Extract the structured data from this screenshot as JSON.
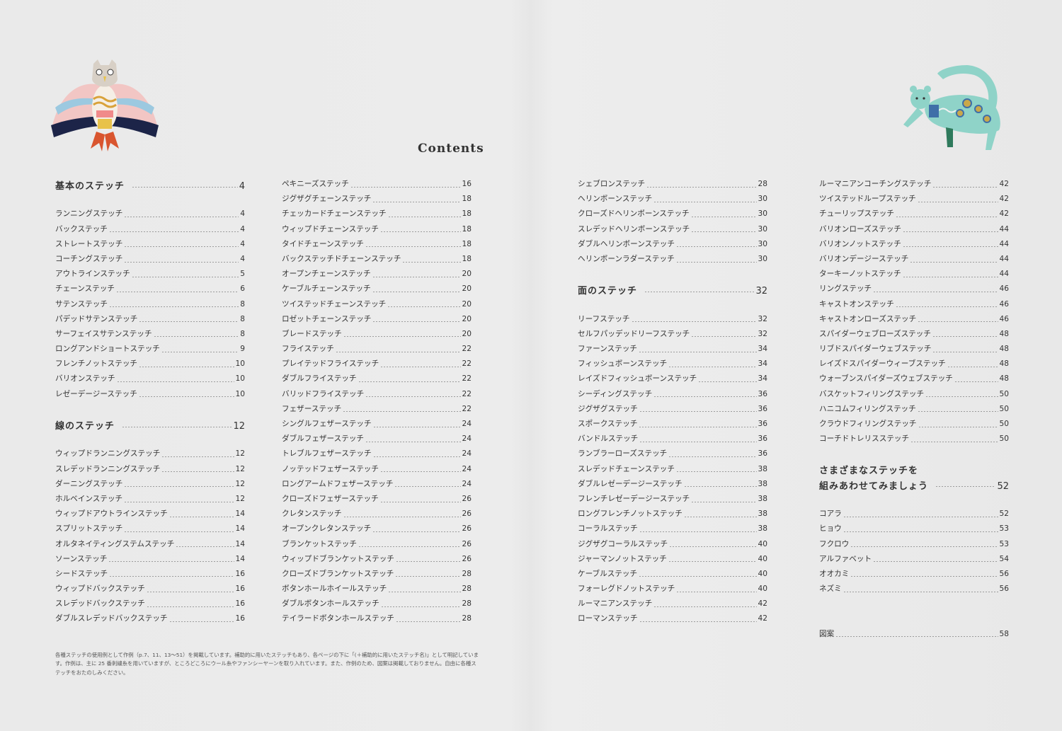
{
  "title": "Contents",
  "columns": [
    [
      {
        "type": "sec",
        "label": "基本のステッチ",
        "page": "4"
      },
      {
        "type": "gap"
      },
      {
        "label": "ランニングステッチ",
        "page": "4"
      },
      {
        "label": "バックステッチ",
        "page": "4"
      },
      {
        "label": "ストレートステッチ",
        "page": "4"
      },
      {
        "label": "コーチングステッチ",
        "page": "4"
      },
      {
        "label": "アウトラインステッチ",
        "page": "5"
      },
      {
        "label": "チェーンステッチ",
        "page": "6"
      },
      {
        "label": "サテンステッチ",
        "page": "8"
      },
      {
        "label": "パデッドサテンステッチ",
        "page": "8"
      },
      {
        "label": "サーフェイスサテンステッチ",
        "page": "8"
      },
      {
        "label": "ロングアンドショートステッチ",
        "page": "9"
      },
      {
        "label": "フレンチノットステッチ",
        "page": "10"
      },
      {
        "label": "バリオンステッチ",
        "page": "10"
      },
      {
        "label": "レゼーデージーステッチ",
        "page": "10"
      },
      {
        "type": "gap"
      },
      {
        "type": "sec",
        "label": "線のステッチ",
        "page": "12"
      },
      {
        "type": "gap"
      },
      {
        "label": "ウィップドランニングステッチ",
        "page": "12"
      },
      {
        "label": "スレデッドランニングステッチ",
        "page": "12"
      },
      {
        "label": "ダーニングステッチ",
        "page": "12"
      },
      {
        "label": "ホルベインステッチ",
        "page": "12"
      },
      {
        "label": "ウィップドアウトラインステッチ",
        "page": "14"
      },
      {
        "label": "スプリットステッチ",
        "page": "14"
      },
      {
        "label": "オルタネイティングステムステッチ",
        "page": "14"
      },
      {
        "label": "ソーンステッチ",
        "page": "14"
      },
      {
        "label": "シードステッチ",
        "page": "16"
      },
      {
        "label": "ウィップドバックステッチ",
        "page": "16"
      },
      {
        "label": "スレデッドバックステッチ",
        "page": "16"
      },
      {
        "label": "ダブルスレデッドバックステッチ",
        "page": "16"
      }
    ],
    [
      {
        "label": "ペキニーズステッチ",
        "page": "16"
      },
      {
        "label": "ジグザグチェーンステッチ",
        "page": "18"
      },
      {
        "label": "チェッカードチェーンステッチ",
        "page": "18"
      },
      {
        "label": "ウィップドチェーンステッチ",
        "page": "18"
      },
      {
        "label": "タイドチェーンステッチ",
        "page": "18"
      },
      {
        "label": "バックステッチドチェーンステッチ",
        "page": "18"
      },
      {
        "label": "オープンチェーンステッチ",
        "page": "20"
      },
      {
        "label": "ケーブルチェーンステッチ",
        "page": "20"
      },
      {
        "label": "ツイステッドチェーンステッチ",
        "page": "20"
      },
      {
        "label": "ロゼットチェーンステッチ",
        "page": "20"
      },
      {
        "label": "ブレードステッチ",
        "page": "20"
      },
      {
        "label": "フライステッチ",
        "page": "22"
      },
      {
        "label": "プレイテッドフライステッチ",
        "page": "22"
      },
      {
        "label": "ダブルフライステッチ",
        "page": "22"
      },
      {
        "label": "バリッドフライステッチ",
        "page": "22"
      },
      {
        "label": "フェザーステッチ",
        "page": "22"
      },
      {
        "label": "シングルフェザーステッチ",
        "page": "24"
      },
      {
        "label": "ダブルフェザーステッチ",
        "page": "24"
      },
      {
        "label": "トレブルフェザーステッチ",
        "page": "24"
      },
      {
        "label": "ノッテッドフェザーステッチ",
        "page": "24"
      },
      {
        "label": "ロングアームドフェザーステッチ",
        "page": "24"
      },
      {
        "label": "クローズドフェザーステッチ",
        "page": "26"
      },
      {
        "label": "クレタンステッチ",
        "page": "26"
      },
      {
        "label": "オープンクレタンステッチ",
        "page": "26"
      },
      {
        "label": "ブランケットステッチ",
        "page": "26"
      },
      {
        "label": "ウィップドブランケットステッチ",
        "page": "26"
      },
      {
        "label": "クローズドブランケットステッチ",
        "page": "28"
      },
      {
        "label": "ボタンホールホイールステッチ",
        "page": "28"
      },
      {
        "label": "ダブルボタンホールステッチ",
        "page": "28"
      },
      {
        "label": "テイラードボタンホールステッチ",
        "page": "28"
      }
    ],
    [
      {
        "label": "シェブロンステッチ",
        "page": "28"
      },
      {
        "label": "ヘリンボーンステッチ",
        "page": "30"
      },
      {
        "label": "クローズドヘリンボーンステッチ",
        "page": "30"
      },
      {
        "label": "スレデッドヘリンボーンステッチ",
        "page": "30"
      },
      {
        "label": "ダブルヘリンボーンステッチ",
        "page": "30"
      },
      {
        "label": "ヘリンボーンラダーステッチ",
        "page": "30"
      },
      {
        "type": "gap"
      },
      {
        "type": "sec",
        "label": "面のステッチ",
        "page": "32"
      },
      {
        "type": "gap"
      },
      {
        "label": "リーフステッチ",
        "page": "32"
      },
      {
        "label": "セルフパッデッドリーフステッチ",
        "page": "32"
      },
      {
        "label": "ファーンステッチ",
        "page": "34"
      },
      {
        "label": "フィッシュボーンステッチ",
        "page": "34"
      },
      {
        "label": "レイズドフィッシュボーンステッチ",
        "page": "34"
      },
      {
        "label": "シーディングステッチ",
        "page": "36"
      },
      {
        "label": "ジグザグステッチ",
        "page": "36"
      },
      {
        "label": "スポークステッチ",
        "page": "36"
      },
      {
        "label": "バンドルステッチ",
        "page": "36"
      },
      {
        "label": "ランブラーローズステッチ",
        "page": "36"
      },
      {
        "label": "スレデッドチェーンステッチ",
        "page": "38"
      },
      {
        "label": "ダブルレゼーデージーステッチ",
        "page": "38"
      },
      {
        "label": "フレンチレゼーデージーステッチ",
        "page": "38"
      },
      {
        "label": "ロングフレンチノットステッチ",
        "page": "38"
      },
      {
        "label": "コーラルステッチ",
        "page": "38"
      },
      {
        "label": "ジグザグコーラルステッチ",
        "page": "40"
      },
      {
        "label": "ジャーマンノットステッチ",
        "page": "40"
      },
      {
        "label": "ケーブルステッチ",
        "page": "40"
      },
      {
        "label": "フォーレグドノットステッチ",
        "page": "40"
      },
      {
        "label": "ルーマニアンステッチ",
        "page": "42"
      },
      {
        "label": "ローマンステッチ",
        "page": "42"
      }
    ],
    [
      {
        "label": "ルーマニアンコーチングステッチ",
        "page": "42"
      },
      {
        "label": "ツイステッドループステッチ",
        "page": "42"
      },
      {
        "label": "チューリップステッチ",
        "page": "42"
      },
      {
        "label": "バリオンローズステッチ",
        "page": "44"
      },
      {
        "label": "バリオンノットステッチ",
        "page": "44"
      },
      {
        "label": "バリオンデージーステッチ",
        "page": "44"
      },
      {
        "label": "ターキーノットステッチ",
        "page": "44"
      },
      {
        "label": "リングステッチ",
        "page": "46"
      },
      {
        "label": "キャストオンステッチ",
        "page": "46"
      },
      {
        "label": "キャストオンローズステッチ",
        "page": "46"
      },
      {
        "label": "スパイダーウェブローズステッチ",
        "page": "48"
      },
      {
        "label": "リブドスパイダーウェブステッチ",
        "page": "48"
      },
      {
        "label": "レイズドスパイダーウィーブステッチ",
        "page": "48"
      },
      {
        "label": "ウォーブンスパイダーズウェブステッチ",
        "page": "48"
      },
      {
        "label": "バスケットフィリングステッチ",
        "page": "50"
      },
      {
        "label": "ハニコムフィリングステッチ",
        "page": "50"
      },
      {
        "label": "クラウドフィリングステッチ",
        "page": "50"
      },
      {
        "label": "コーチドトレリスステッチ",
        "page": "50"
      },
      {
        "type": "gap"
      },
      {
        "type": "sec2",
        "label": "さまざまなステッチを"
      },
      {
        "type": "sec",
        "label": "組みあわせてみましょう",
        "page": "52"
      },
      {
        "type": "gap"
      },
      {
        "label": "コアラ",
        "page": "52"
      },
      {
        "label": "ヒョウ",
        "page": "53"
      },
      {
        "label": "フクロウ",
        "page": "53"
      },
      {
        "label": "アルファベット",
        "page": "54"
      },
      {
        "label": "オオカミ",
        "page": "56"
      },
      {
        "label": "ネズミ",
        "page": "56"
      },
      {
        "type": "gap"
      },
      {
        "type": "gap"
      },
      {
        "label": "図案",
        "page": "58"
      }
    ]
  ],
  "note": "各種ステッチの使用例として作例（p.7、11、13〜51）を掲載しています。補助的に用いたステッチもあり、各ページの下に「(＋補助的に用いたステッチ名)」として明記しています。作例は、主に 25 番刺繍糸を用いていますが、ところどころにウール糸やファンシーヤーンを取り入れています。また、作例のため、図案は掲載しておりません。自由に各種ステッチをおたのしみください。",
  "colors": {
    "owl_wing": "#f2b7b8",
    "owl_accent": "#e8c24a",
    "owl_feet": "#d9552f",
    "leopard_body": "#8fd3c8",
    "leopard_spots": "#3f6fa8"
  }
}
